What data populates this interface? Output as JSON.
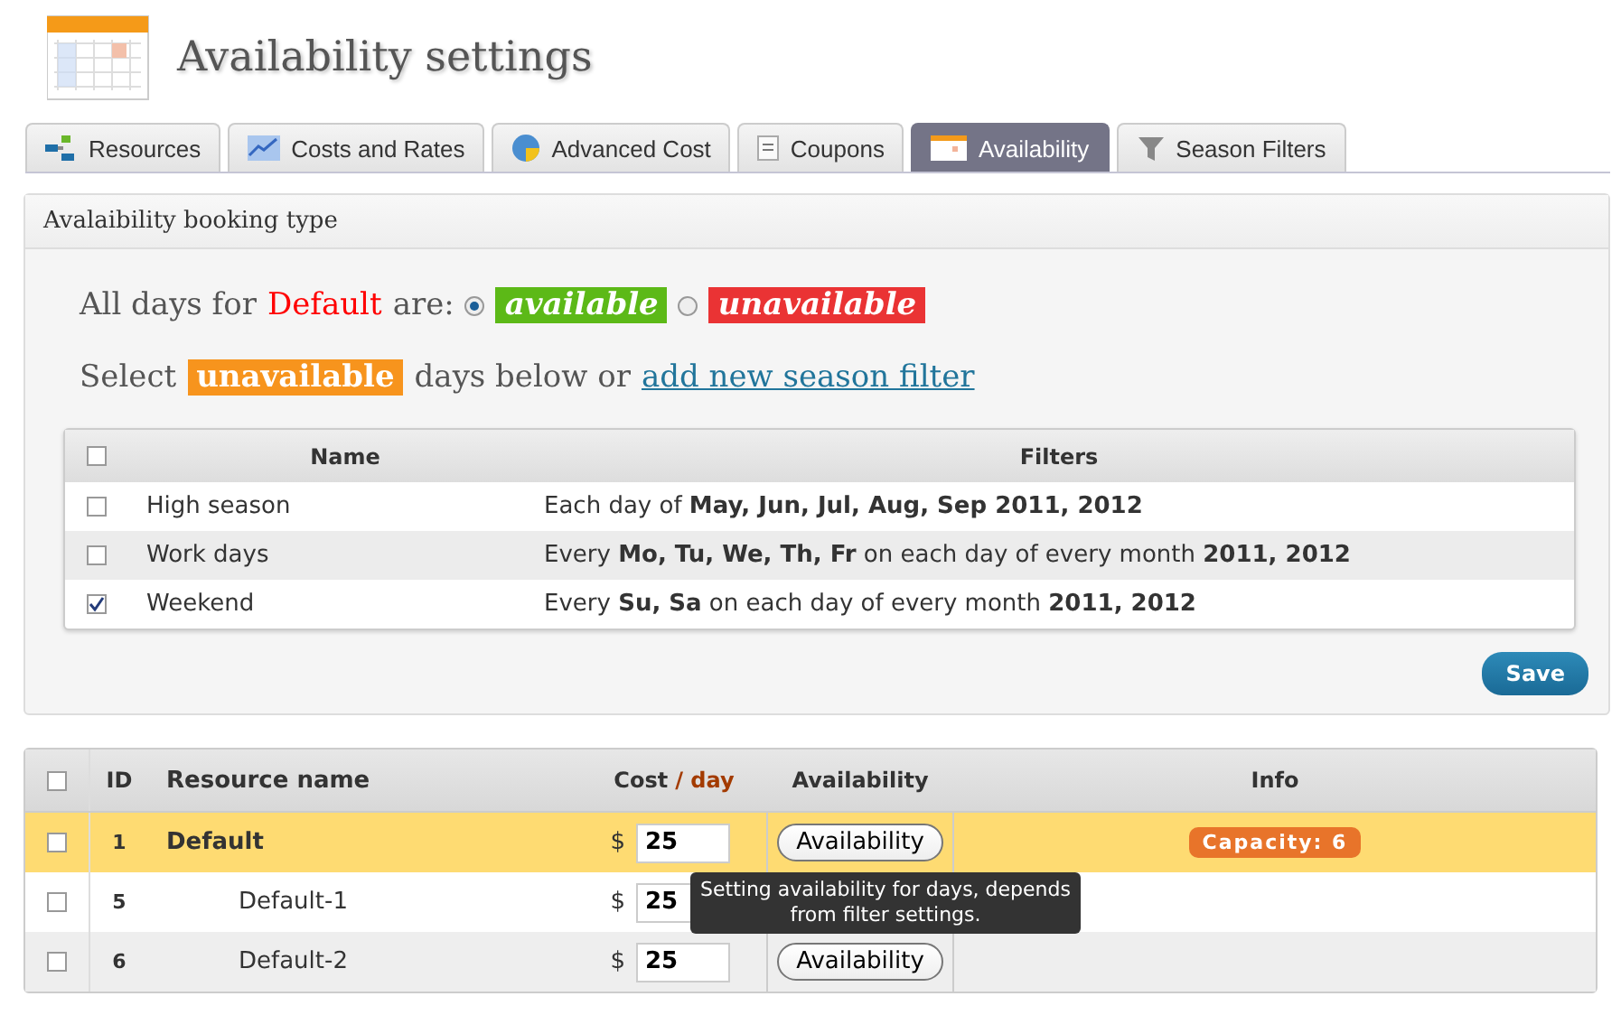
{
  "page": {
    "title": "Availability settings"
  },
  "tabs": [
    {
      "label": "Resources",
      "selected": false
    },
    {
      "label": "Costs and Rates",
      "selected": false
    },
    {
      "label": "Advanced Cost",
      "selected": false
    },
    {
      "label": "Coupons",
      "selected": false
    },
    {
      "label": "Availability",
      "selected": true
    },
    {
      "label": "Season Filters",
      "selected": false
    }
  ],
  "panel": {
    "title": "Avalaibility booking type",
    "all_days": {
      "prefix": "All days for",
      "resource": "Default",
      "suffix": "are:",
      "options": [
        {
          "label": "available",
          "color": "#5cb917",
          "selected": true
        },
        {
          "label": "unavailable",
          "color": "#ea3334",
          "selected": false
        }
      ]
    },
    "select_line": {
      "prefix": "Select",
      "badge": "unavailable",
      "middle": "days below or",
      "link": "add new season filter"
    },
    "filters": {
      "columns": [
        "Name",
        "Filters"
      ],
      "all_checked": false,
      "rows": [
        {
          "name": "High season",
          "filter": "Each day of **May, Jun, Jul, Aug, Sep 2011, 2012**",
          "checked": false
        },
        {
          "name": "Work days",
          "filter": "Every **Mo, Tu, We, Th, Fr** on each day of every month **2011, 2012**",
          "checked": false
        },
        {
          "name": "Weekend",
          "filter": "Every **Su, Sa** on each day of every month **2011, 2012**",
          "checked": true
        }
      ]
    },
    "save": "Save"
  },
  "resources": {
    "all_checked": false,
    "columns": {
      "id": "ID",
      "name": "Resource name",
      "cost": "Cost",
      "cost_unit": "/ day",
      "availability": "Availability",
      "info": "Info"
    },
    "rows": [
      {
        "id": "1",
        "name": "Default",
        "currency": "$",
        "cost": "25",
        "button": "Availability",
        "info": "Capacity: 6",
        "highlighted": true,
        "child": false,
        "checked": false
      },
      {
        "id": "5",
        "name": "Default-1",
        "currency": "$",
        "cost": "25",
        "highlighted": false,
        "child": true,
        "checked": false
      },
      {
        "id": "6",
        "name": "Default-2",
        "currency": "$",
        "cost": "25",
        "button": "Availability",
        "highlighted": false,
        "child": true,
        "checked": false
      }
    ]
  },
  "tooltip": "Setting availability for days, depends from filter settings."
}
